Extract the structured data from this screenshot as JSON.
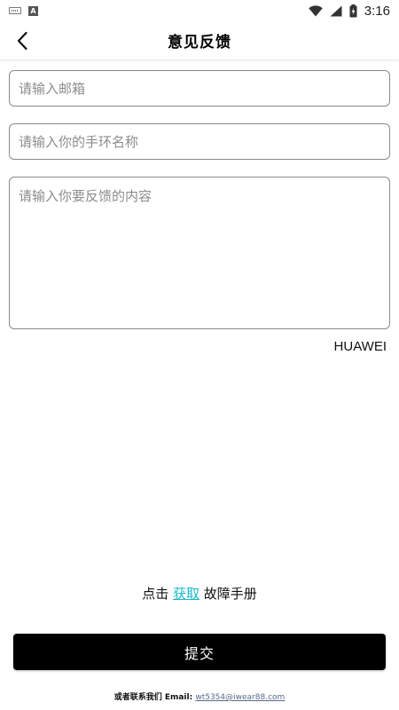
{
  "status_bar": {
    "time": "3:16",
    "icons": [
      "keyboard-icon",
      "a-notification-icon",
      "wifi-icon",
      "signal-icon",
      "battery-icon"
    ]
  },
  "header": {
    "title": "意见反馈",
    "back_icon": "chevron-left-icon"
  },
  "form": {
    "email_placeholder": "请输入邮箱",
    "email_value": "",
    "band_name_placeholder": "请输入你的手环名称",
    "band_name_value": "",
    "feedback_placeholder": "请输入你要反馈的内容",
    "feedback_value": ""
  },
  "device_name": "HUAWEI",
  "manual": {
    "prefix": "点击",
    "link": "获取",
    "suffix": "故障手册"
  },
  "submit_label": "提交",
  "contact": {
    "prefix": "或者联系我们 Email:",
    "email": "wt5354@iwear88.com"
  },
  "colors": {
    "link": "#19b9c8",
    "button_bg": "#000000",
    "button_text": "#ffffff",
    "field_border": "#8a8a8a"
  }
}
